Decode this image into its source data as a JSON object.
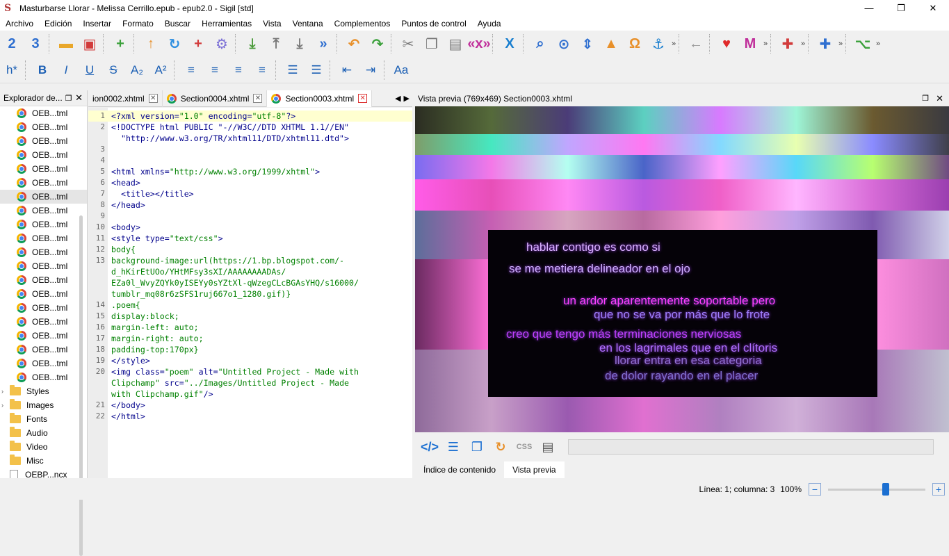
{
  "window": {
    "title": "Masturbarse  Llorar - Melissa Cerrillo.epub - epub2.0 - Sigil [std]",
    "minimize": "—",
    "maximize": "❐",
    "close": "✕"
  },
  "menu": [
    "Archivo",
    "Edición",
    "Insertar",
    "Formato",
    "Buscar",
    "Herramientas",
    "Vista",
    "Ventana",
    "Complementos",
    "Puntos de control",
    "Ayuda"
  ],
  "toolbar1": [
    {
      "name": "new-book-icon",
      "glyph": "2",
      "color": "#2f6fd0"
    },
    {
      "name": "new-book-3-icon",
      "glyph": "3",
      "color": "#2f6fd0"
    },
    {
      "name": "open-folder-icon",
      "glyph": "▬",
      "color": "#e9a72a"
    },
    {
      "name": "save-icon",
      "glyph": "▣",
      "color": "#d23b3b"
    },
    {
      "name": "add-file-icon",
      "glyph": "+",
      "color": "#3aa03a"
    },
    {
      "name": "up-arrow-icon",
      "glyph": "↑",
      "color": "#e8902a"
    },
    {
      "name": "refresh-icon",
      "glyph": "↻",
      "color": "#2f8fe0"
    },
    {
      "name": "insert-plus-icon",
      "glyph": "+",
      "color": "#d23b3b"
    },
    {
      "name": "settings-gear-icon",
      "glyph": "⚙",
      "color": "#7b6fd6"
    },
    {
      "name": "split-down-icon",
      "glyph": "⤓",
      "color": "#4a9a3a"
    },
    {
      "name": "merge-icon",
      "glyph": "⤒",
      "color": "#777"
    },
    {
      "name": "split-icon",
      "glyph": "⤓",
      "color": "#777"
    },
    {
      "name": "chevrons-icon",
      "glyph": "»",
      "color": "#2f6fd0"
    },
    {
      "name": "undo-icon",
      "glyph": "↶",
      "color": "#e8902a"
    },
    {
      "name": "redo-icon",
      "glyph": "↷",
      "color": "#3aa03a"
    },
    {
      "name": "cut-icon",
      "glyph": "✂",
      "color": "#777"
    },
    {
      "name": "copy-icon",
      "glyph": "❐",
      "color": "#777"
    },
    {
      "name": "paste-icon",
      "glyph": "▤",
      "color": "#777"
    },
    {
      "name": "code-clean-icon",
      "glyph": "«x»",
      "color": "#c02e9a"
    },
    {
      "name": "xml-x-icon",
      "glyph": "X",
      "color": "#1a7fcf"
    },
    {
      "name": "search-icon",
      "glyph": "⌕",
      "color": "#2f6fd0"
    },
    {
      "name": "search-replace-icon",
      "glyph": "⊙",
      "color": "#2f6fd0"
    },
    {
      "name": "split-marker-icon",
      "glyph": "⇕",
      "color": "#2f6fd0"
    },
    {
      "name": "insert-image-icon",
      "glyph": "▲",
      "color": "#e8902a"
    },
    {
      "name": "special-character-icon",
      "glyph": "Ω",
      "color": "#e8902a"
    },
    {
      "name": "anchor-icon",
      "glyph": "⚓",
      "color": "#1a7fcf"
    },
    {
      "name": "back-arrow-icon",
      "glyph": "←",
      "color": "#999"
    },
    {
      "name": "heart-icon",
      "glyph": "♥",
      "color": "#e02a2a"
    },
    {
      "name": "m-plugin-icon",
      "glyph": "M",
      "color": "#c02e9a"
    },
    {
      "name": "plugin-red-icon",
      "glyph": "✚",
      "color": "#d23b3b"
    },
    {
      "name": "plugin-blue-icon",
      "glyph": "✚",
      "color": "#2f6fd0"
    },
    {
      "name": "plugin-tree-icon",
      "glyph": "⌥",
      "color": "#3aa03a"
    }
  ],
  "toolbar2": [
    {
      "name": "heading-icon",
      "glyph": "h*"
    },
    {
      "name": "bold-icon",
      "glyph": "B"
    },
    {
      "name": "italic-icon",
      "glyph": "I"
    },
    {
      "name": "underline-icon",
      "glyph": "U"
    },
    {
      "name": "strikethrough-icon",
      "glyph": "S"
    },
    {
      "name": "subscript-icon",
      "glyph": "A₂"
    },
    {
      "name": "superscript-icon",
      "glyph": "A²"
    },
    {
      "name": "align-left-icon",
      "glyph": "≡"
    },
    {
      "name": "align-center-icon",
      "glyph": "≡"
    },
    {
      "name": "align-right-icon",
      "glyph": "≡"
    },
    {
      "name": "align-justify-icon",
      "glyph": "≡"
    },
    {
      "name": "bullet-list-icon",
      "glyph": "☰"
    },
    {
      "name": "numbered-list-icon",
      "glyph": "☰"
    },
    {
      "name": "decrease-indent-icon",
      "glyph": "⇤"
    },
    {
      "name": "increase-indent-icon",
      "glyph": "⇥"
    },
    {
      "name": "text-case-icon",
      "glyph": "Aa"
    }
  ],
  "explorer": {
    "title": "Explorador de...",
    "files": [
      "OEB...tml",
      "OEB...tml",
      "OEB...tml",
      "OEB...tml",
      "OEB...tml",
      "OEB...tml",
      "OEB...tml",
      "OEB...tml",
      "OEB...tml",
      "OEB...tml",
      "OEB...tml",
      "OEB...tml",
      "OEB...tml",
      "OEB...tml",
      "OEB...tml",
      "OEB...tml",
      "OEB...tml",
      "OEB...tml",
      "OEB...tml",
      "OEB...tml"
    ],
    "selected_index": 6,
    "folders": [
      {
        "label": "Styles",
        "expandable": true
      },
      {
        "label": "Images",
        "expandable": true
      },
      {
        "label": "Fonts",
        "expandable": false
      },
      {
        "label": "Audio",
        "expandable": false
      },
      {
        "label": "Video",
        "expandable": false
      },
      {
        "label": "Misc",
        "expandable": false
      }
    ],
    "last_item": "OEBP...ncx"
  },
  "tabs": [
    {
      "label": "ion0002.xhtml",
      "icon": false,
      "active": false
    },
    {
      "label": "Section0004.xhtml",
      "icon": true,
      "active": false
    },
    {
      "label": "Section0003.xhtml",
      "icon": true,
      "active": true
    }
  ],
  "code_lines": [
    {
      "n": "1",
      "html": "&lt;?xml version=<span class='s'>\"1.0\"</span> encoding=<span class='s'>\"utf-8\"</span>?&gt;"
    },
    {
      "n": "2",
      "html": "&lt;!DOCTYPE html PUBLIC \"-//W3C//DTD XHTML 1.1//EN\""
    },
    {
      "n": "",
      "html": "  \"http://www.w3.org/TR/xhtml11/DTD/xhtml11.dtd\"&gt;"
    },
    {
      "n": "3",
      "html": ""
    },
    {
      "n": "4",
      "html": ""
    },
    {
      "n": "5",
      "html": "&lt;html xmlns=<span class='s'>\"http://www.w3.org/1999/xhtml\"</span>&gt;"
    },
    {
      "n": "6",
      "html": "&lt;head&gt;"
    },
    {
      "n": "7",
      "html": "  &lt;title&gt;&lt;/title&gt;"
    },
    {
      "n": "8",
      "html": "&lt;/head&gt;"
    },
    {
      "n": "9",
      "html": ""
    },
    {
      "n": "10",
      "html": "&lt;body&gt;"
    },
    {
      "n": "11",
      "html": "&lt;style type=<span class='s'>\"text/css\"</span>&gt;"
    },
    {
      "n": "12",
      "html": "<span class='s'>body{</span>"
    },
    {
      "n": "13",
      "html": "<span class='s'>background-image:url(https://1.bp.blogspot.com/-</span>"
    },
    {
      "n": "",
      "html": "<span class='s'>d_hKirEtUOo/YHtMFsy3sXI/AAAAAAAADAs/</span>"
    },
    {
      "n": "",
      "html": "<span class='s'>EZa0l_WvyZQYk0yISEYy0sYZtXl-qWzegCLcBGAsYHQ/s16000/</span>"
    },
    {
      "n": "",
      "html": "<span class='s'>tumblr_mq08r6zSFS1ruj667o1_1280.gif)}</span>"
    },
    {
      "n": "14",
      "html": "<span class='s'>.poem{</span>"
    },
    {
      "n": "15",
      "html": "<span class='s'>display:block;</span>"
    },
    {
      "n": "16",
      "html": "<span class='s'>margin-left: auto;</span>"
    },
    {
      "n": "17",
      "html": "<span class='s'>margin-right: auto;</span>"
    },
    {
      "n": "18",
      "html": "<span class='s'>padding-top:170px}</span>"
    },
    {
      "n": "19",
      "html": "&lt;/style&gt;"
    },
    {
      "n": "20",
      "html": "&lt;img class=<span class='s'>\"poem\"</span> alt=<span class='s'>\"Untitled Project - Made with</span>"
    },
    {
      "n": "",
      "html": "<span class='s'>Clipchamp\"</span> src=<span class='s'>\"../Images/Untitled Project - Made</span>"
    },
    {
      "n": "",
      "html": "<span class='s'>with Clipchamp.gif\"</span>/&gt;"
    },
    {
      "n": "21",
      "html": "&lt;/body&gt;"
    },
    {
      "n": "22",
      "html": "&lt;/html&gt;"
    }
  ],
  "preview": {
    "title": "Vista previa (769x469) Section0003.xhtml",
    "poem_lines": [
      "hablar contigo es como si",
      "se me metiera delineador en el ojo",
      "un ardor aparentemente soportable pero",
      "que no se va por más que lo frote",
      "creo que tengo más terminaciones nerviosas",
      "en los lagrimales que en el clítoris",
      "llorar entra en esa categoria",
      "de dolor rayando en el placer"
    ]
  },
  "bottom_tabs": [
    "Índice de contenido",
    "Vista previa"
  ],
  "status": {
    "position": "Línea: 1; columna: 3",
    "zoom": "100%",
    "zoom_level": "100%"
  }
}
